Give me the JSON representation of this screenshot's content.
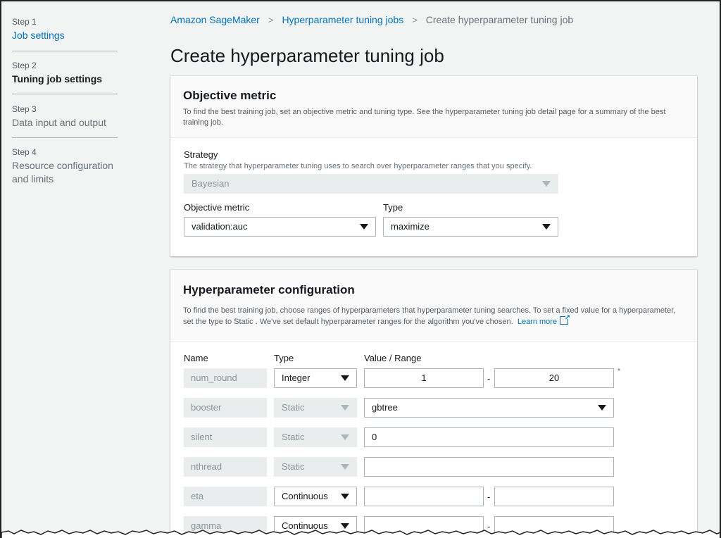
{
  "nav": {
    "steps": [
      {
        "num": "Step 1",
        "title": "Job settings"
      },
      {
        "num": "Step 2",
        "title": "Tuning job settings"
      },
      {
        "num": "Step 3",
        "title": "Data input and output"
      },
      {
        "num": "Step 4",
        "title": "Resource configuration and limits"
      }
    ]
  },
  "breadcrumb": [
    "Amazon SageMaker",
    "Hyperparameter tuning jobs",
    "Create hyperparameter tuning job"
  ],
  "page_title": "Create hyperparameter tuning job",
  "objective": {
    "title": "Objective metric",
    "description": "To find the best training job, set an objective metric and tuning type. See the hyperparameter tuning job detail page for a summary of the best training job.",
    "strategy_label": "Strategy",
    "strategy_desc": "The strategy that hyperparameter tuning uses to search over hyperparameter ranges that you specify.",
    "strategy_value": "Bayesian",
    "metric_label": "Objective metric",
    "metric_value": "validation:auc",
    "type_label": "Type",
    "type_value": "maximize"
  },
  "hyper": {
    "title": "Hyperparameter configuration",
    "description": "To find the best training job, choose ranges of hyperparameters that hyperparameter tuning searches. To set a fixed value for a hyperparameter, set the type to Static . We've set default hyperparameter ranges for the algorithm you've chosen.",
    "learn_more": "Learn more",
    "col_name": "Name",
    "col_type": "Type",
    "col_value": "Value / Range",
    "rows": [
      {
        "name": "num_round",
        "type": "Integer",
        "min": "1",
        "max": "20"
      },
      {
        "name": "booster",
        "type": "Static",
        "value": "gbtree"
      },
      {
        "name": "silent",
        "type": "Static",
        "value": "0"
      },
      {
        "name": "nthread",
        "type": "Static",
        "value": ""
      },
      {
        "name": "eta",
        "type": "Continuous",
        "min": "",
        "max": ""
      },
      {
        "name": "gamma",
        "type": "Continuous",
        "min": "",
        "max": ""
      }
    ],
    "dash": "-",
    "required_mark": "*"
  }
}
